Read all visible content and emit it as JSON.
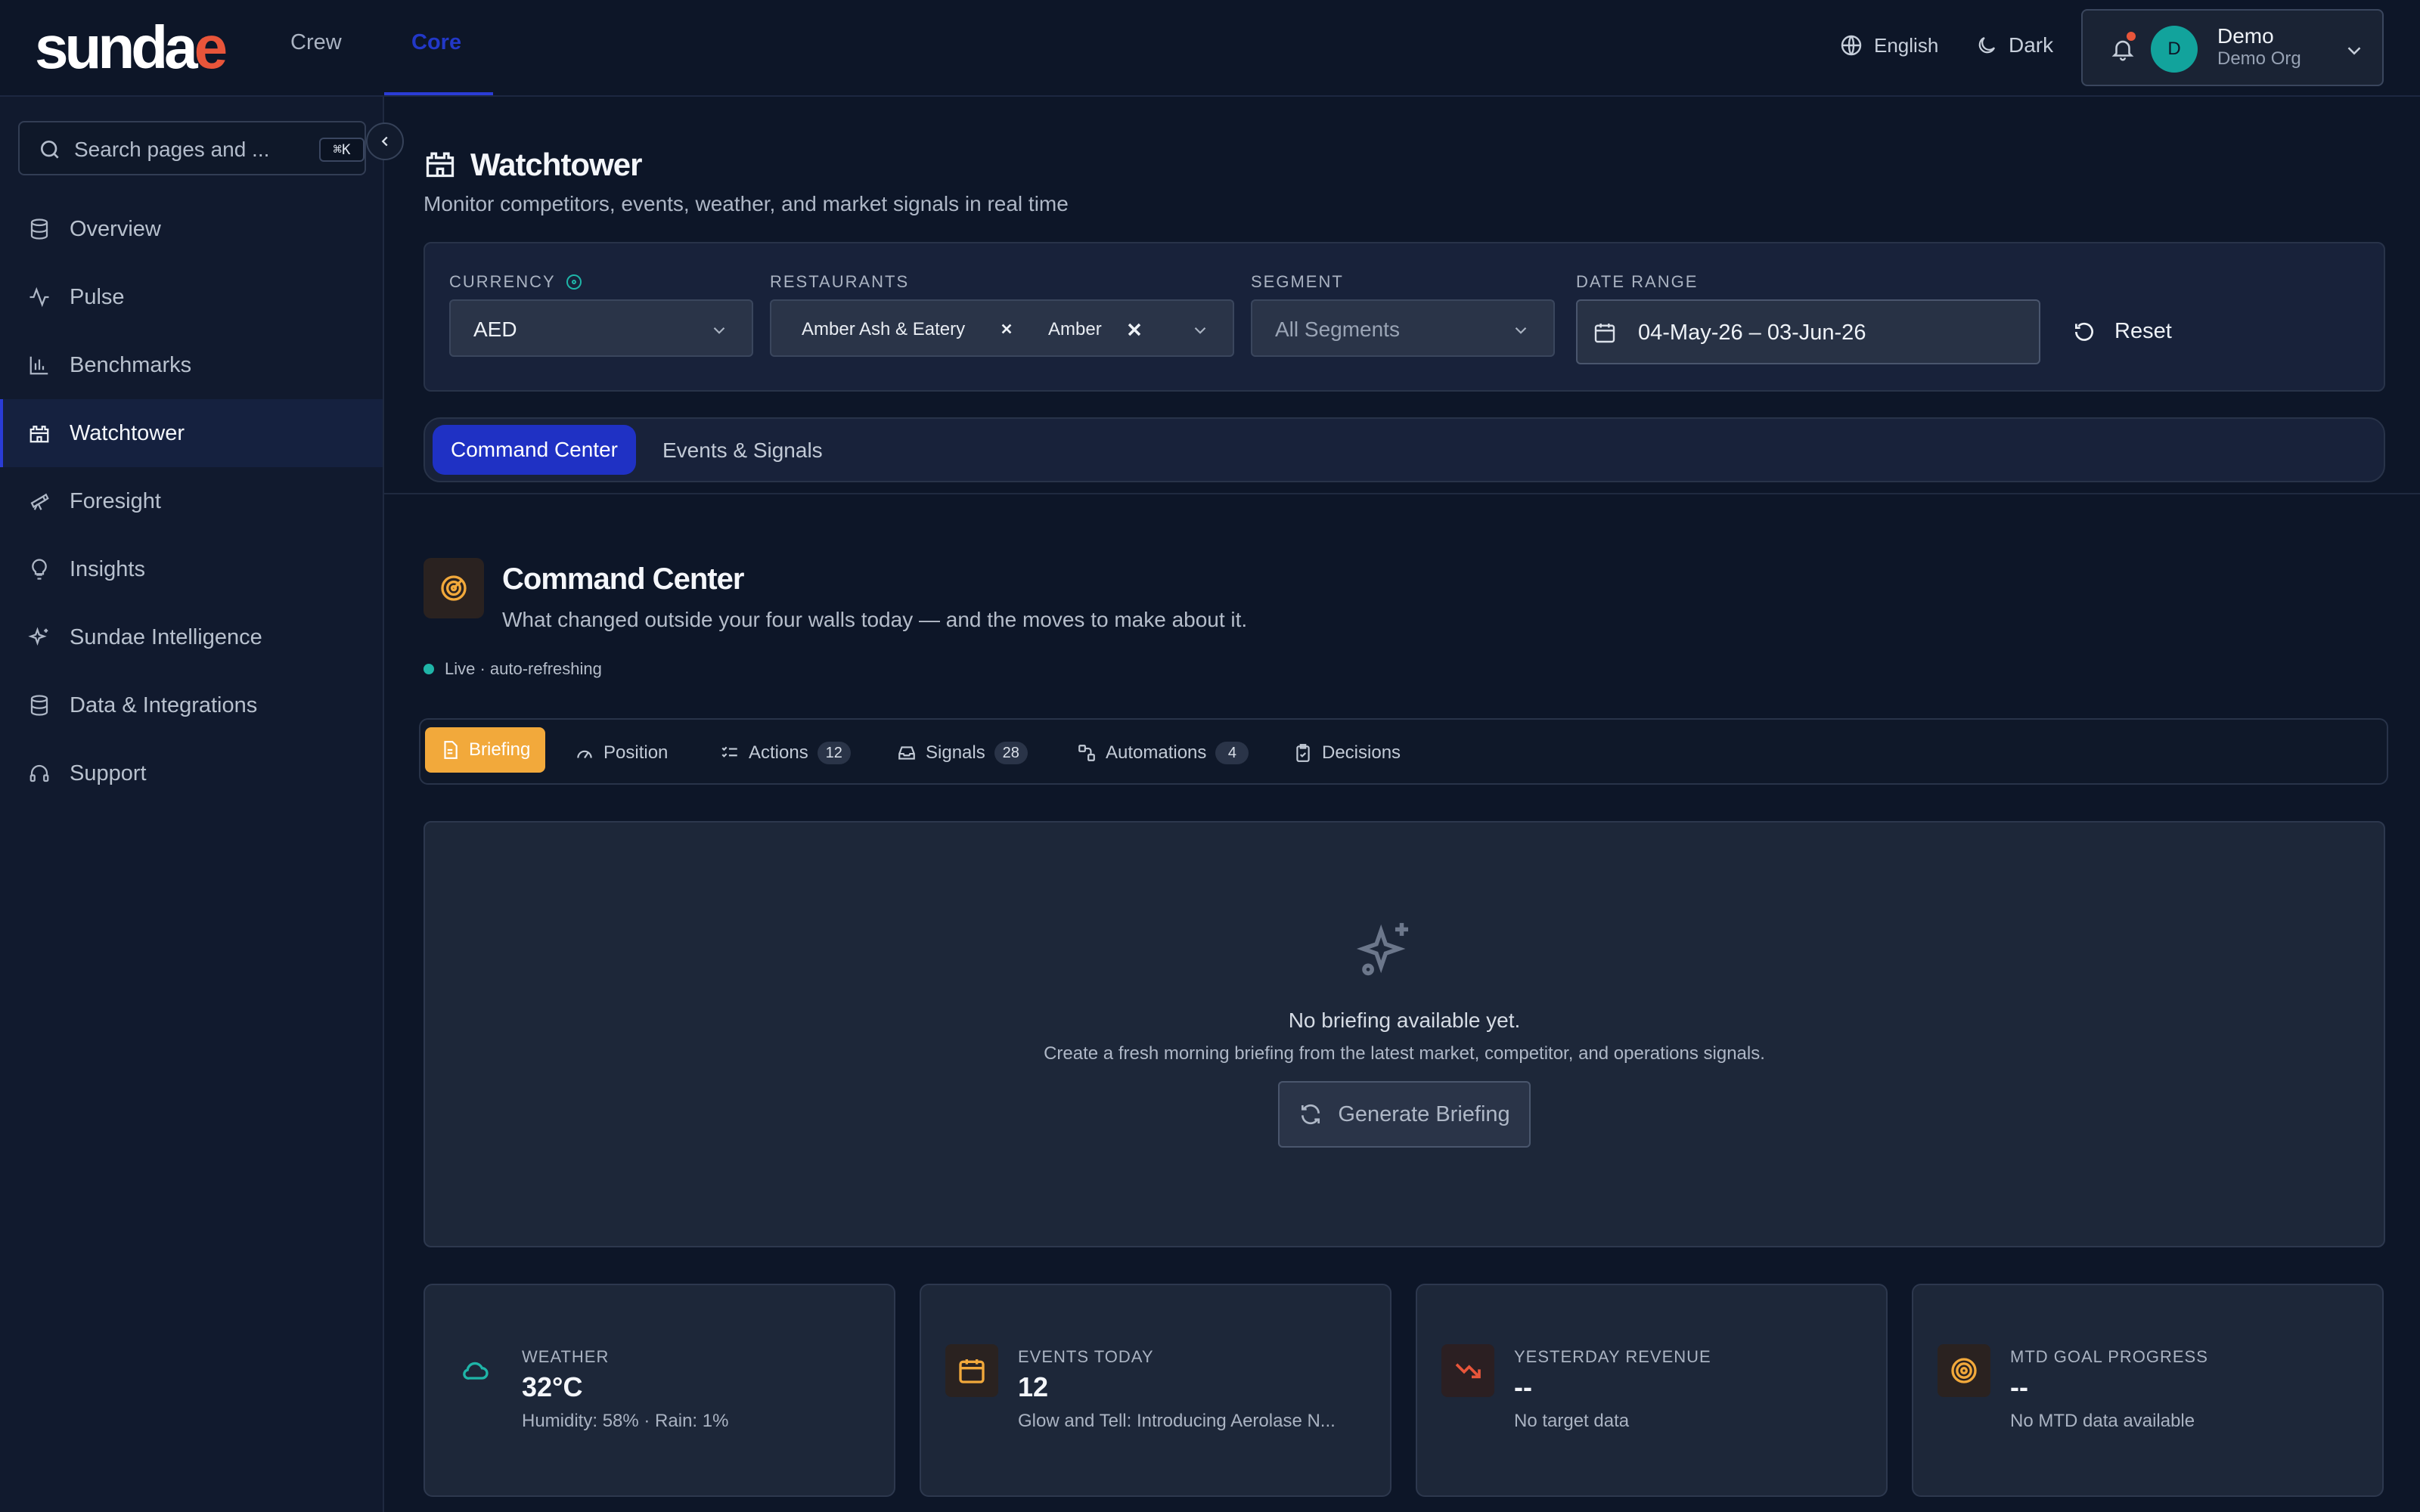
{
  "brand": {
    "logo_main": "sunda",
    "logo_last": "e"
  },
  "topnav": {
    "crew": "Crew",
    "core": "Core"
  },
  "header": {
    "language": "English",
    "theme": "Dark",
    "user_initial": "D",
    "user_name": "Demo",
    "user_org": "Demo Org"
  },
  "sidebar": {
    "search_placeholder": "Search pages and ...",
    "search_shortcut": "⌘K",
    "items": [
      {
        "label": "Overview",
        "icon": "database-icon"
      },
      {
        "label": "Pulse",
        "icon": "activity-icon"
      },
      {
        "label": "Benchmarks",
        "icon": "bar-chart-icon"
      },
      {
        "label": "Watchtower",
        "icon": "castle-icon",
        "active": true
      },
      {
        "label": "Foresight",
        "icon": "telescope-icon"
      },
      {
        "label": "Insights",
        "icon": "lightbulb-icon"
      },
      {
        "label": "Sundae Intelligence",
        "icon": "sparkles-icon"
      },
      {
        "label": "Data & Integrations",
        "icon": "database-icon"
      },
      {
        "label": "Support",
        "icon": "headset-icon"
      }
    ]
  },
  "page": {
    "title": "Watchtower",
    "subtitle": "Monitor competitors, events, weather, and market signals in real time"
  },
  "filters": {
    "currency_label": "CURRENCY",
    "currency_value": "AED",
    "restaurants_label": "RESTAURANTS",
    "restaurants": [
      "Amber Ash & Eatery",
      "Amber"
    ],
    "segment_label": "SEGMENT",
    "segment_value": "All Segments",
    "date_label": "DATE RANGE",
    "date_value": "04-May-26 – 03-Jun-26",
    "reset_label": "Reset"
  },
  "tabs": {
    "active": "Command Center",
    "other": "Events & Signals"
  },
  "command_center": {
    "title": "Command Center",
    "subtitle": "What changed outside your four walls today — and the moves to make about it.",
    "live_text": "Live · auto-refreshing"
  },
  "subtabs": [
    {
      "label": "Briefing",
      "icon": "file-text-icon",
      "active": true
    },
    {
      "label": "Position",
      "icon": "gauge-icon"
    },
    {
      "label": "Actions",
      "icon": "checklist-icon",
      "badge": "12"
    },
    {
      "label": "Signals",
      "icon": "inbox-icon",
      "badge": "28"
    },
    {
      "label": "Automations",
      "icon": "workflow-icon",
      "badge": "4"
    },
    {
      "label": "Decisions",
      "icon": "clipboard-icon"
    }
  ],
  "briefing": {
    "title": "No briefing available yet.",
    "subtitle": "Create a fresh morning briefing from the latest market, competitor, and operations signals.",
    "button_label": "Generate Briefing"
  },
  "cards": [
    {
      "label": "WEATHER",
      "value": "32°C",
      "sub": "Humidity: 58% · Rain: 1%",
      "icon": "cloud-icon",
      "accent": "#1fb5a8"
    },
    {
      "label": "EVENTS TODAY",
      "value": "12",
      "sub": "Glow and Tell: Introducing Aerolase N...",
      "icon": "calendar-icon",
      "accent": "#f2a93b"
    },
    {
      "label": "YESTERDAY REVENUE",
      "value": "--",
      "sub": "No target data",
      "icon": "trending-down-icon",
      "accent": "#e8553a"
    },
    {
      "label": "MTD GOAL PROGRESS",
      "value": "--",
      "sub": "No MTD data available",
      "icon": "target-icon",
      "accent": "#f2a93b"
    }
  ],
  "colors": {
    "background": "#0d1628",
    "accent_blue": "#1f31c4",
    "accent_orange": "#f2a93b",
    "accent_teal": "#1fb5a8",
    "accent_red": "#e8553a"
  }
}
